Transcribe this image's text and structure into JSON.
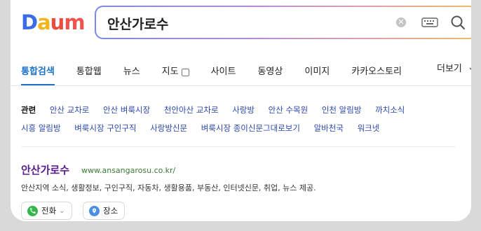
{
  "logo": {
    "text": "Daum",
    "d": "D",
    "a": "a",
    "u": "u",
    "m": "m"
  },
  "search": {
    "query": "안산가로수"
  },
  "icons": {
    "clear": "clear-circle-icon",
    "keyboard": "keyboard-icon",
    "search": "search-icon"
  },
  "tabs": [
    {
      "label": "통합검색",
      "active": true
    },
    {
      "label": "통합웹"
    },
    {
      "label": "뉴스"
    },
    {
      "label": "지도"
    },
    {
      "label": "사이트"
    },
    {
      "label": "동영상"
    },
    {
      "label": "이미지"
    },
    {
      "label": "카카오스토리"
    }
  ],
  "more": {
    "label": "더보기"
  },
  "related": {
    "label": "관련",
    "items": [
      "안산 교차로",
      "안산 벼룩시장",
      "천안아산 교차로",
      "사랑방",
      "안산 수목원",
      "인천 알림방",
      "까치소식",
      "시흥 알림방",
      "벼룩시장 구인구직",
      "사랑방신문",
      "벼룩시장 종이신문그대로보기",
      "알바천국",
      "워크넷"
    ]
  },
  "result": {
    "title": "안산가로수",
    "url": "www.ansangarosu.co.kr/",
    "description": "안산지역 소식, 생활정보, 구인구직, 자동차, 생활용품, 부동산, 인터넷신문, 취업, 뉴스 제공."
  },
  "chips": {
    "phone": "전화",
    "place": "장소"
  },
  "colors": {
    "accent": "#1a73c8",
    "title": "#5b1b8f",
    "url": "#3a7a33",
    "link": "#2b48a8"
  }
}
